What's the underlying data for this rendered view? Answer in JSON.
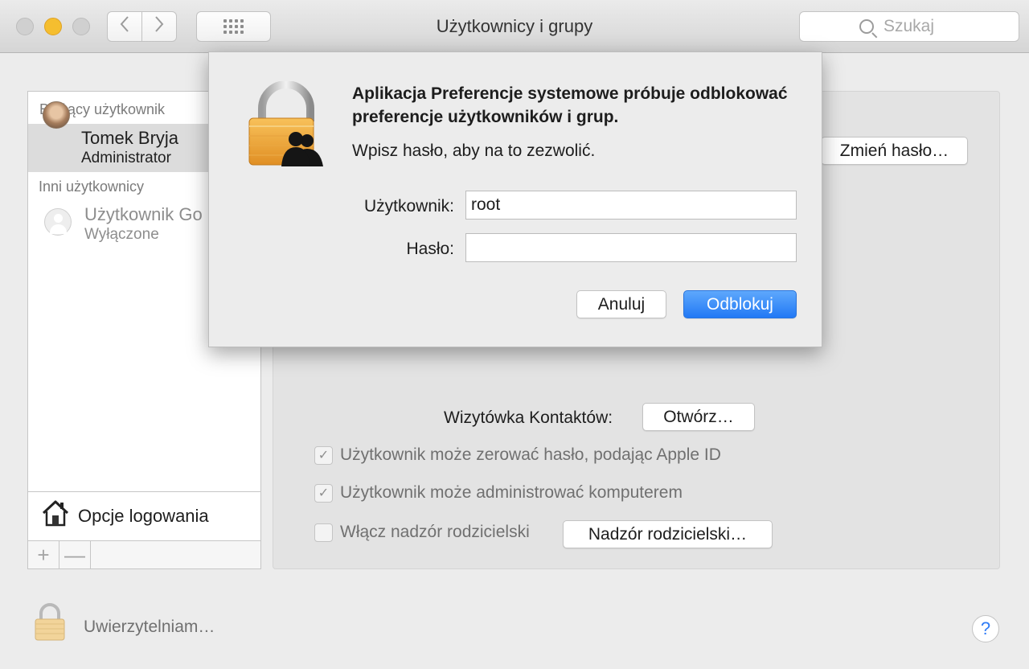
{
  "window": {
    "title": "Użytkownicy i grupy",
    "search_placeholder": "Szukaj"
  },
  "sidebar": {
    "current_heading": "Bieżący użytkownik",
    "current_user": {
      "name": "Tomek Bryja",
      "role": "Administrator"
    },
    "others_heading": "Inni użytkownicy",
    "other_users": [
      {
        "name": "Użytkownik Go",
        "role": "Wyłączone"
      }
    ],
    "login_options_label": "Opcje logowania",
    "add_label": "+",
    "remove_label": "—"
  },
  "main": {
    "change_password_label": "Zmień hasło…",
    "contacts_label": "Wizytówka Kontaktów:",
    "open_label": "Otwórz…",
    "checkboxes": [
      {
        "label": "Użytkownik może zerować hasło, podając Apple ID",
        "checked": true
      },
      {
        "label": "Użytkownik może administrować komputerem",
        "checked": true
      },
      {
        "label": "Włącz nadzór rodzicielski",
        "checked": false
      }
    ],
    "parental_button_label": "Nadzór rodzicielski…"
  },
  "bottom": {
    "auth_status": "Uwierzytelniam…",
    "help_label": "?"
  },
  "dialog": {
    "title": "Aplikacja Preferencje systemowe próbuje odblokować preferencje użytkowników i grup.",
    "subtitle": "Wpisz hasło, aby na to zezwolić.",
    "user_label": "Użytkownik:",
    "user_value": "root",
    "password_label": "Hasło:",
    "password_value": "",
    "cancel_label": "Anuluj",
    "unlock_label": "Odblokuj"
  },
  "colors": {
    "accent": "#2279f5",
    "minimize": "#f5be2f",
    "lock_gold": "#f0a93a"
  },
  "icons": {
    "back": "chevron-left-icon",
    "forward": "chevron-right-icon",
    "grid": "grid-icon",
    "search": "search-icon",
    "lock": "lock-icon",
    "users": "users-icon",
    "home": "house-icon",
    "help": "help-icon",
    "checkmark": "checkmark-icon"
  }
}
